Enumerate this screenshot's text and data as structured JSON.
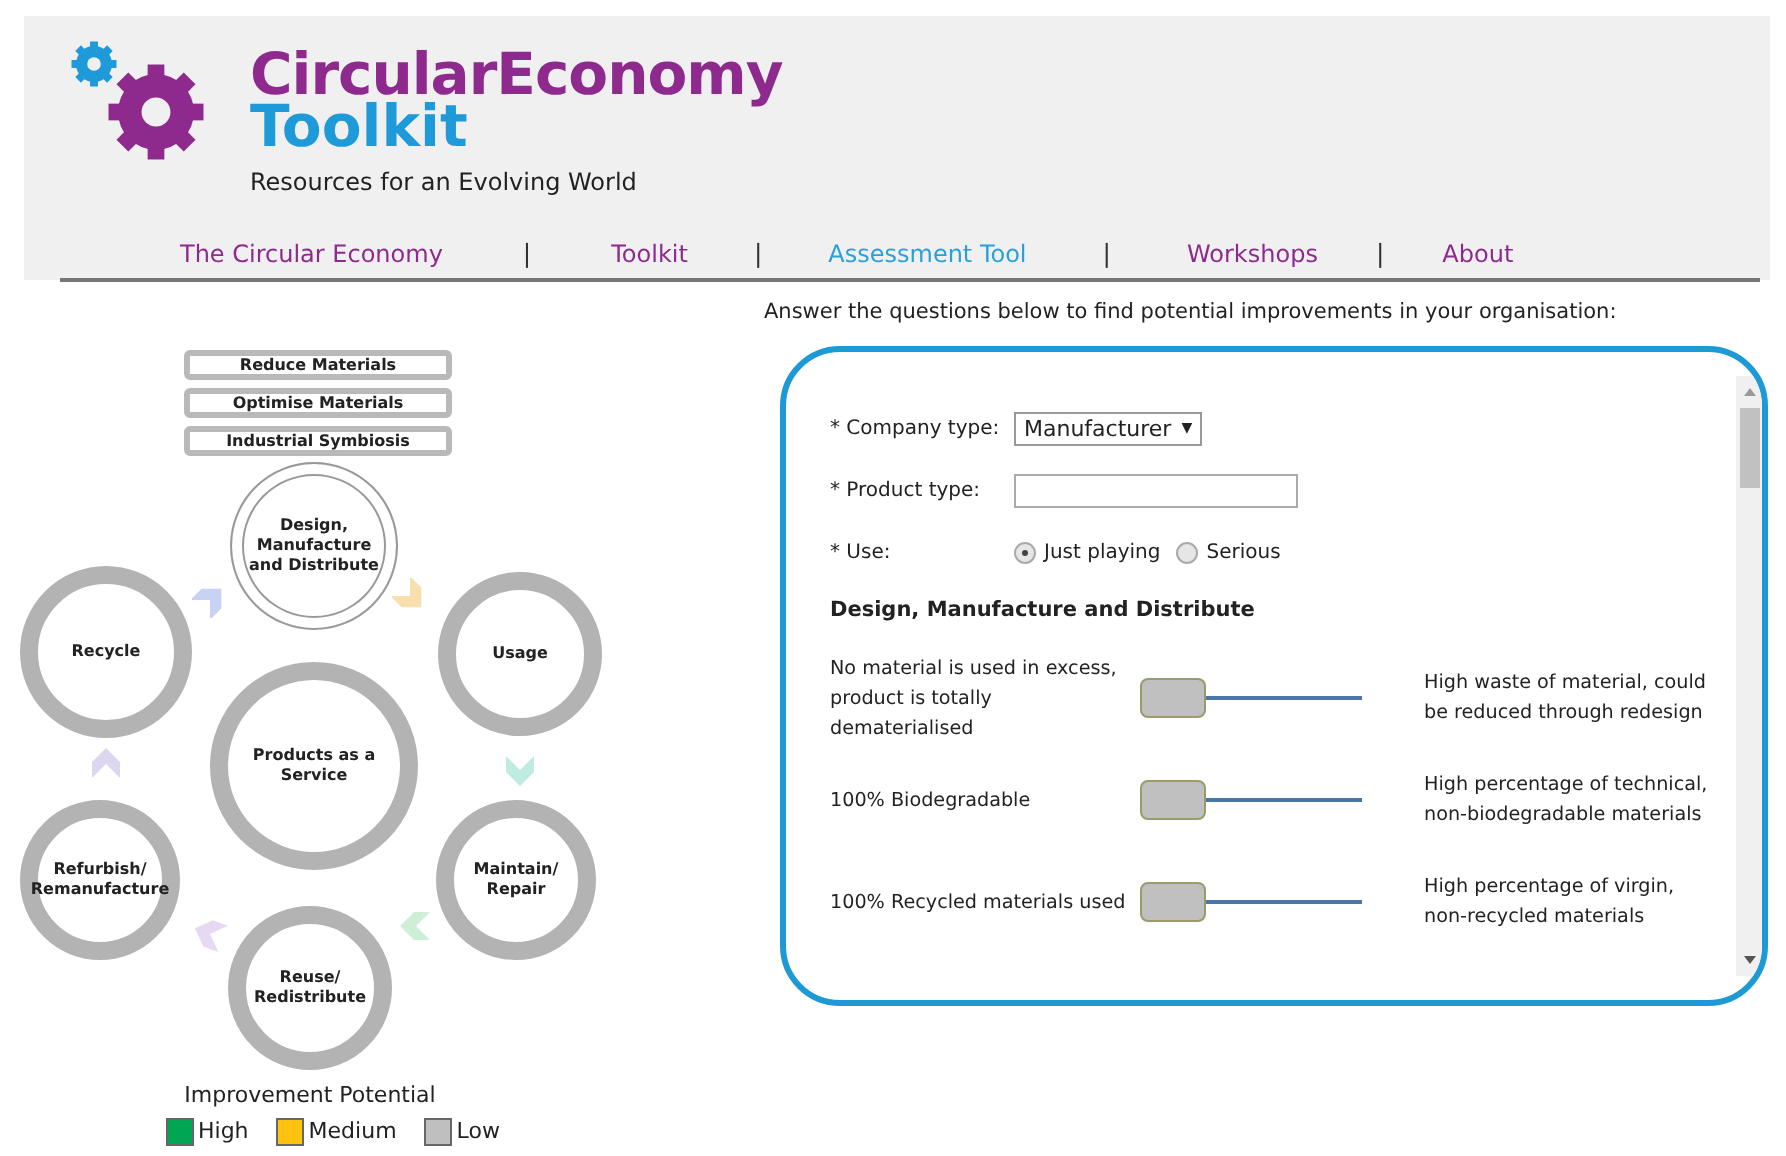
{
  "header": {
    "title": "CircularEconomy",
    "subtitle": "Toolkit",
    "tagline": "Resources for an Evolving World"
  },
  "nav": {
    "items": [
      {
        "label": "The Circular Economy",
        "selected": false
      },
      {
        "label": "Toolkit",
        "selected": false
      },
      {
        "label": "Assessment Tool",
        "selected": true
      },
      {
        "label": "Workshops",
        "selected": false
      },
      {
        "label": "About",
        "selected": false
      }
    ],
    "separators": [
      "|",
      "|",
      "|",
      "|"
    ]
  },
  "diagram": {
    "strategies": [
      "Reduce Materials",
      "Optimise Materials",
      "Industrial Symbiosis"
    ],
    "stages": [
      {
        "label": "Design, Manufacture and Distribute",
        "selected": true
      },
      {
        "label": "Recycle",
        "selected": false
      },
      {
        "label": "Usage",
        "selected": false
      },
      {
        "label": "Products as a Service",
        "selected": false
      },
      {
        "label": "Refurbish/ Remanufacture",
        "selected": false
      },
      {
        "label": "Maintain/ Repair",
        "selected": false
      },
      {
        "label": "Reuse/ Redistribute",
        "selected": false
      }
    ],
    "legend": {
      "title": "Improvement Potential",
      "items": [
        {
          "label": "High",
          "color": "#00a651"
        },
        {
          "label": "Medium",
          "color": "#ffc20e"
        },
        {
          "label": "Low",
          "color": "#bfbfbf"
        }
      ]
    }
  },
  "form": {
    "intro": "Answer the questions below to find potential improvements in your organisation:",
    "company_type": {
      "label": "* Company type:",
      "value": "Manufacturer",
      "caret": "▼"
    },
    "product_type": {
      "label": "* Product type:"
    },
    "use": {
      "label": "* Use:",
      "options": [
        {
          "label": "Just playing",
          "selected": true
        },
        {
          "label": "Serious",
          "selected": false
        }
      ]
    },
    "section": "Design, Manufacture and Distribute",
    "sliders": [
      {
        "low_label": "No material is used in excess, product is totally dematerialised",
        "high_label": "High waste of material, could be reduced through redesign"
      },
      {
        "low_label": "100% Biodegradable",
        "high_label": "High percentage of technical, non-biodegradable materials"
      },
      {
        "low_label": "100% Recycled materials used",
        "high_label": "High percentage of virgin, non-recycled materials"
      }
    ]
  }
}
